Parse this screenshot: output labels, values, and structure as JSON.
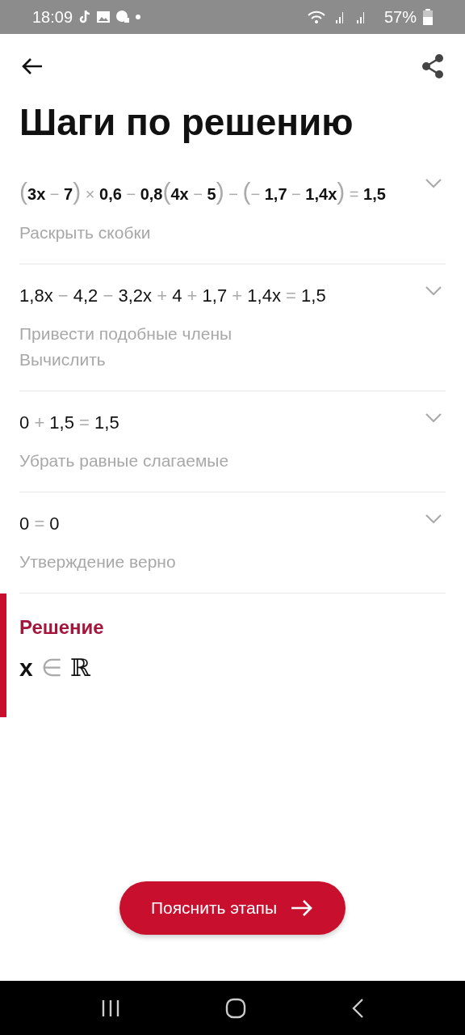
{
  "status_bar": {
    "time": "18:09",
    "battery": "57%"
  },
  "title": "Шаги по решению",
  "steps": [
    {
      "expression": "(3x − 7) × 0,6 − 0,8(4x − 5) − (− 1,7 − 1,4x) = 1,5",
      "emphasized": true,
      "expanded": false,
      "descriptions": [
        "Раскрыть скобки"
      ]
    },
    {
      "expression": "1,8x − 4,2 − 3,2x + 4 + 1,7 + 1,4x = 1,5",
      "emphasized": false,
      "expanded": false,
      "descriptions": [
        "Привести подобные члены",
        "Вычислить"
      ]
    },
    {
      "expression": "0 + 1,5 = 1,5",
      "emphasized": false,
      "expanded": false,
      "descriptions": [
        "Убрать равные слагаемые"
      ]
    },
    {
      "expression": "0 = 0",
      "emphasized": false,
      "expanded": false,
      "descriptions": [
        "Утверждение верно"
      ]
    }
  ],
  "solution": {
    "heading": "Решение",
    "variable": "x",
    "relation": "∈",
    "set": "ℝ"
  },
  "explain_button": "Пояснить этапы"
}
